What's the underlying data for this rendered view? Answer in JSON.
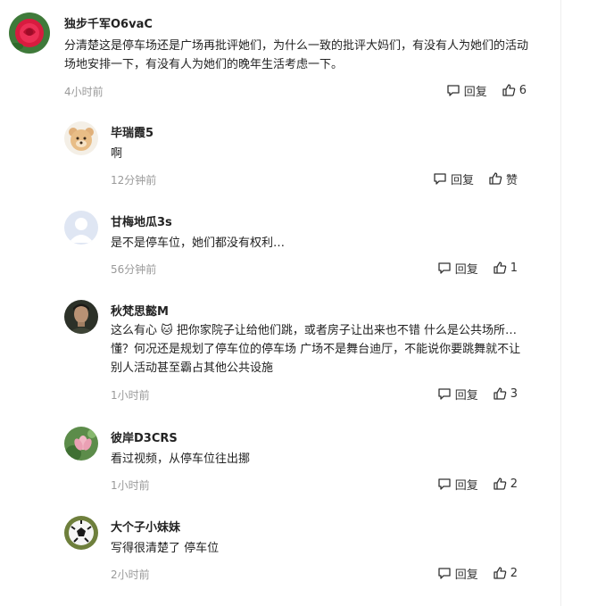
{
  "comments": [
    {
      "user": "独步千军O6vaC",
      "text": "分清楚这是停车场还是广场再批评她们，为什么一致的批评大妈们，有没有人为她们的活动场地安排一下，有没有人为她们的晚年生活考虑一下。",
      "time": "4小时前",
      "reply": "回复",
      "likes": "6",
      "avatar": "rose"
    },
    {
      "user": "毕瑞霞5",
      "text": "啊",
      "time": "12分钟前",
      "reply": "回复",
      "likes": "赞",
      "avatar": "bear"
    },
    {
      "user": "甘梅地瓜3s",
      "text": "是不是停车位，她们都没有权利…",
      "time": "56分钟前",
      "reply": "回复",
      "likes": "1",
      "avatar": "default"
    },
    {
      "user": "秋梵思懿M",
      "text": "这么有心 🐱 把你家院子让给他们跳，或者房子让出来也不错 什么是公共场所…懂？何况还是规划了停车位的停车场 广场不是舞台迪厅，不能说你要跳舞就不让别人活动甚至霸占其他公共设施",
      "time": "1小时前",
      "reply": "回复",
      "likes": "3",
      "avatar": "man"
    },
    {
      "user": "彼岸D3CRS",
      "text": "看过视频，从停车位往出挪",
      "time": "1小时前",
      "reply": "回复",
      "likes": "2",
      "avatar": "lotus"
    },
    {
      "user": "大个子小妹妹",
      "text": "写得很清楚了 停车位",
      "time": "2小时前",
      "reply": "回复",
      "likes": "2",
      "avatar": "soccer"
    }
  ]
}
